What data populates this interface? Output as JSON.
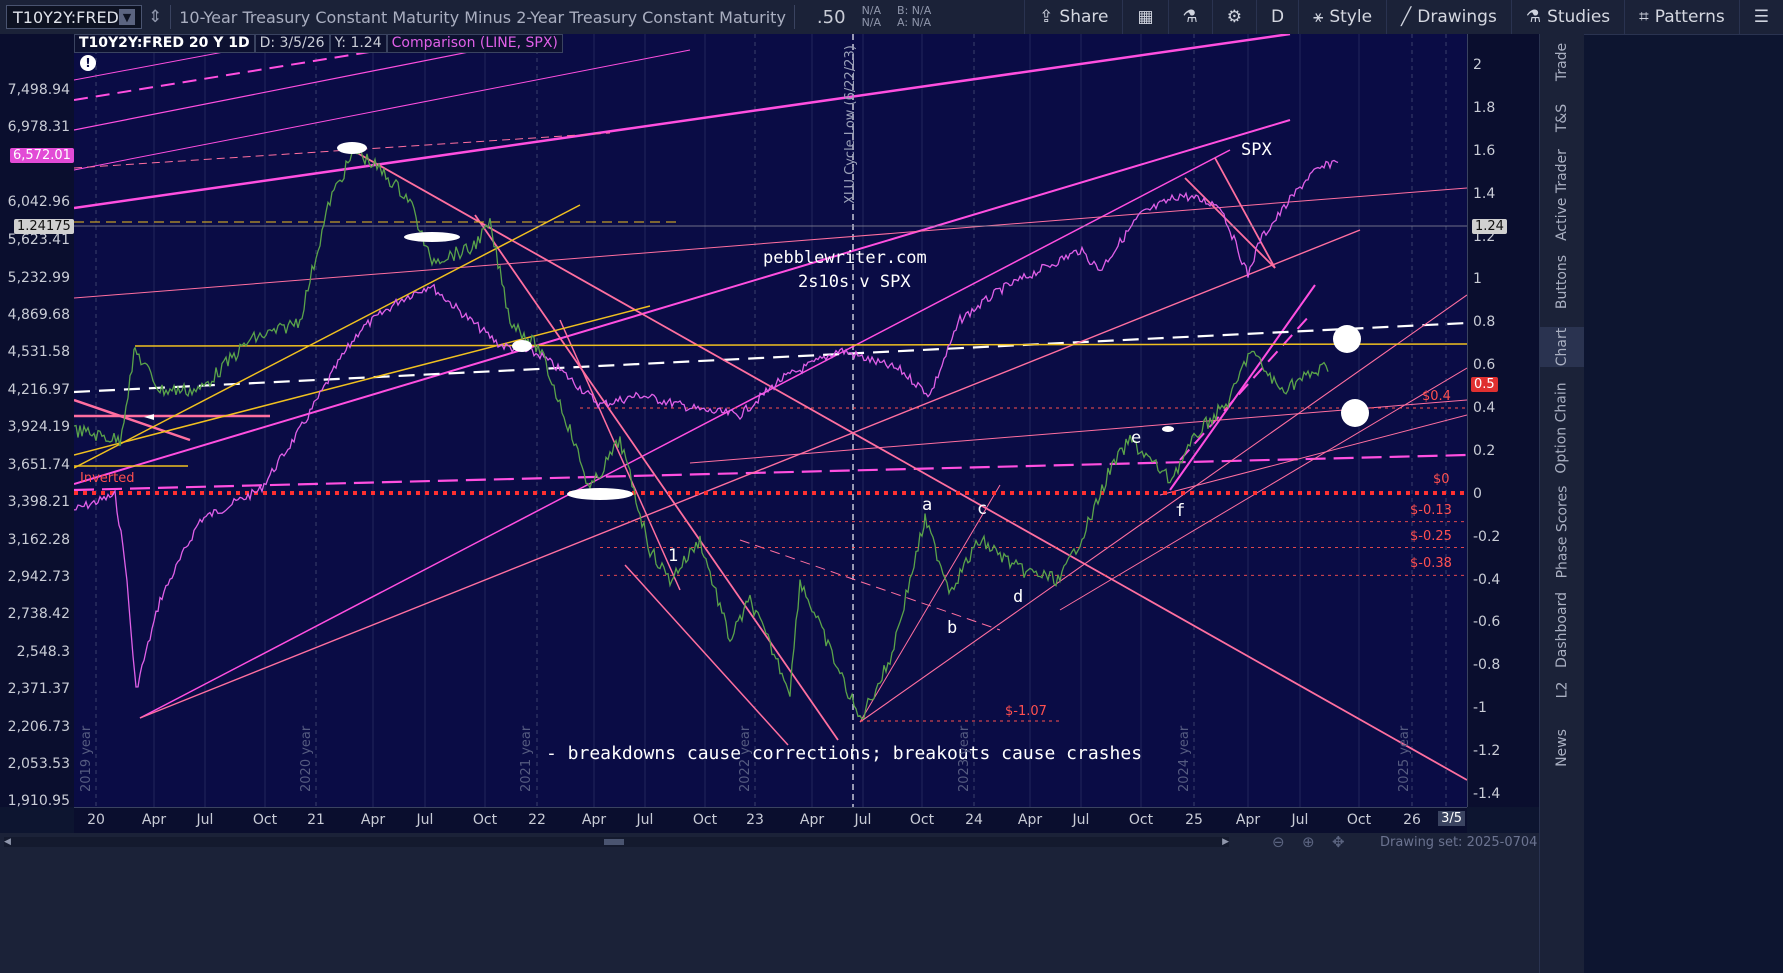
{
  "toolbar": {
    "symbol": "T10Y2Y:FRED",
    "title": "10-Year Treasury Constant Maturity Minus 2-Year Treasury Constant Maturity",
    "last_value": ".50",
    "quote_na1": "N/A",
    "quote_na2": "N/A",
    "quote_bid": "B: N/A",
    "quote_ask": "A: N/A",
    "share": "Share",
    "interval": "D",
    "style": "Style",
    "drawings": "Drawings",
    "studies": "Studies",
    "patterns": "Patterns"
  },
  "legend": {
    "symbol_period": "T10Y2Y:FRED 20 Y 1D",
    "date": "D: 3/5/26",
    "yvalue": "Y: 1.24",
    "comparison": "Comparison (LINE, SPX)"
  },
  "left_axis_labels": [
    "7,498.94",
    "6,978.31",
    "6,572.01",
    "6,042.96",
    "5,623.41",
    "5,232.99",
    "4,869.68",
    "4,531.58",
    "4,216.97",
    "3,924.19",
    "3,651.74",
    "3,398.21",
    "3,162.28",
    "2,942.73",
    "2,738.42",
    "2,548.3",
    "2,371.37",
    "2,206.73",
    "2,053.53",
    "1,910.95"
  ],
  "left_tags": {
    "spx_price": "6,572.01",
    "spread_price": "1.24175"
  },
  "right_axis_labels": [
    "2",
    "1.8",
    "1.6",
    "1.4",
    "1.2",
    "1",
    "0.8",
    "0.6",
    "0.4",
    "0.2",
    "0",
    "-0.2",
    "-0.4",
    "-0.6",
    "-0.8",
    "-1",
    "-1.2",
    "-1.4"
  ],
  "right_tags": {
    "crosshair": "1.24",
    "last": "0.5"
  },
  "x_axis_labels": [
    "20",
    "Apr",
    "Jul",
    "Oct",
    "21",
    "Apr",
    "Jul",
    "Oct",
    "22",
    "Apr",
    "Jul",
    "Oct",
    "23",
    "Apr",
    "Jul",
    "Oct",
    "24",
    "Apr",
    "Jul",
    "Oct",
    "25",
    "Apr",
    "Jul",
    "Oct",
    "26"
  ],
  "x_axis_end": "3/5",
  "year_markers": [
    "2019 year",
    "2020 year",
    "2021 year",
    "2022 year",
    "2023 year",
    "2024 year",
    "2025 year"
  ],
  "annotations": {
    "site": "pebblewriter.com",
    "subtitle": "2s10s v SPX",
    "spx": "SPX",
    "footer": "- breakdowns cause corrections; breakouts cause crashes",
    "inverted": "Inverted",
    "xlu": "XLU Cycle Low (6/22/23)",
    "waves": [
      "a",
      "b",
      "c",
      "d",
      "e",
      "f",
      "1"
    ],
    "levels": [
      "$0.4",
      "$0",
      "$-0.13",
      "$-0.25",
      "$-0.38",
      "$-1.07"
    ]
  },
  "right_panel_tabs": [
    "Trade",
    "T&S",
    "Active Trader",
    "Buttons",
    "Chart",
    "Option Chain",
    "Phase Scores",
    "Dashboard",
    "L2",
    "News"
  ],
  "status": {
    "drawing_set": "Drawing set: 2025-0704"
  },
  "colors": {
    "background": "#0a0c45",
    "spx_line": "#e060e8",
    "spread_line": "#5aa34a",
    "trend_pink": "#ff6fa0",
    "trend_yellow": "#f0c020",
    "channel_magenta": "#ff4fe0",
    "zero_line": "#ff3030"
  }
}
